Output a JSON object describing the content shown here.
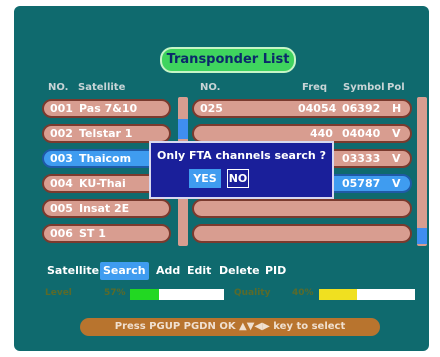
{
  "title": "Transponder List",
  "headers": {
    "no_left": "NO.",
    "satellite": "Satellite",
    "no_right": "NO.",
    "freq": "Freq",
    "symbol": "Symbol",
    "pol": "Pol"
  },
  "satellites": [
    {
      "no": "001",
      "name": "Pas 7&10",
      "selected": false
    },
    {
      "no": "002",
      "name": "Telstar 1",
      "selected": false
    },
    {
      "no": "003",
      "name": "Thaicom",
      "selected": true
    },
    {
      "no": "004",
      "name": "KU-Thai",
      "selected": false
    },
    {
      "no": "005",
      "name": "Insat 2E",
      "selected": false
    },
    {
      "no": "006",
      "name": "ST 1",
      "selected": false
    }
  ],
  "transponders": [
    {
      "no": "025",
      "freq": "04054",
      "symbol": "06392",
      "pol": "H",
      "selected": false
    },
    {
      "no": "",
      "freq": "440",
      "symbol": "04040",
      "pol": "V",
      "selected": false
    },
    {
      "no": "",
      "freq": "190",
      "symbol": "03333",
      "pol": "V",
      "selected": false
    },
    {
      "no": "",
      "freq": "175",
      "symbol": "05787",
      "pol": "V",
      "selected": true
    },
    {
      "no": "",
      "freq": "",
      "symbol": "",
      "pol": "",
      "selected": false
    },
    {
      "no": "",
      "freq": "",
      "symbol": "",
      "pol": "",
      "selected": false
    }
  ],
  "dialog": {
    "message": "Only FTA channels search ?",
    "yes_label": "YES",
    "no_label": "NO",
    "selected": "yes"
  },
  "menu": {
    "satellite": "Satellite",
    "search": "Search",
    "add": "Add",
    "edit": "Edit",
    "delete": "Delete",
    "pid": "PID",
    "active": "search"
  },
  "signal": {
    "level_label": "Level",
    "level_value": "57%",
    "level_fraction": 0.57,
    "quality_label": "Quality",
    "quality_value": "40%",
    "quality_fraction": 0.4
  },
  "footer": "Press PGUP PGDN OK ▲▼◀▶ key to select",
  "colors": {
    "background": "#0f6a6e",
    "row": "#d89d90",
    "highlight": "#3f9cf0",
    "title_pill": "#3fd45e",
    "dialog": "#1a1f9a",
    "level_bar": "#22d822",
    "quality_bar": "#f0e020",
    "footer": "#b8742e"
  }
}
